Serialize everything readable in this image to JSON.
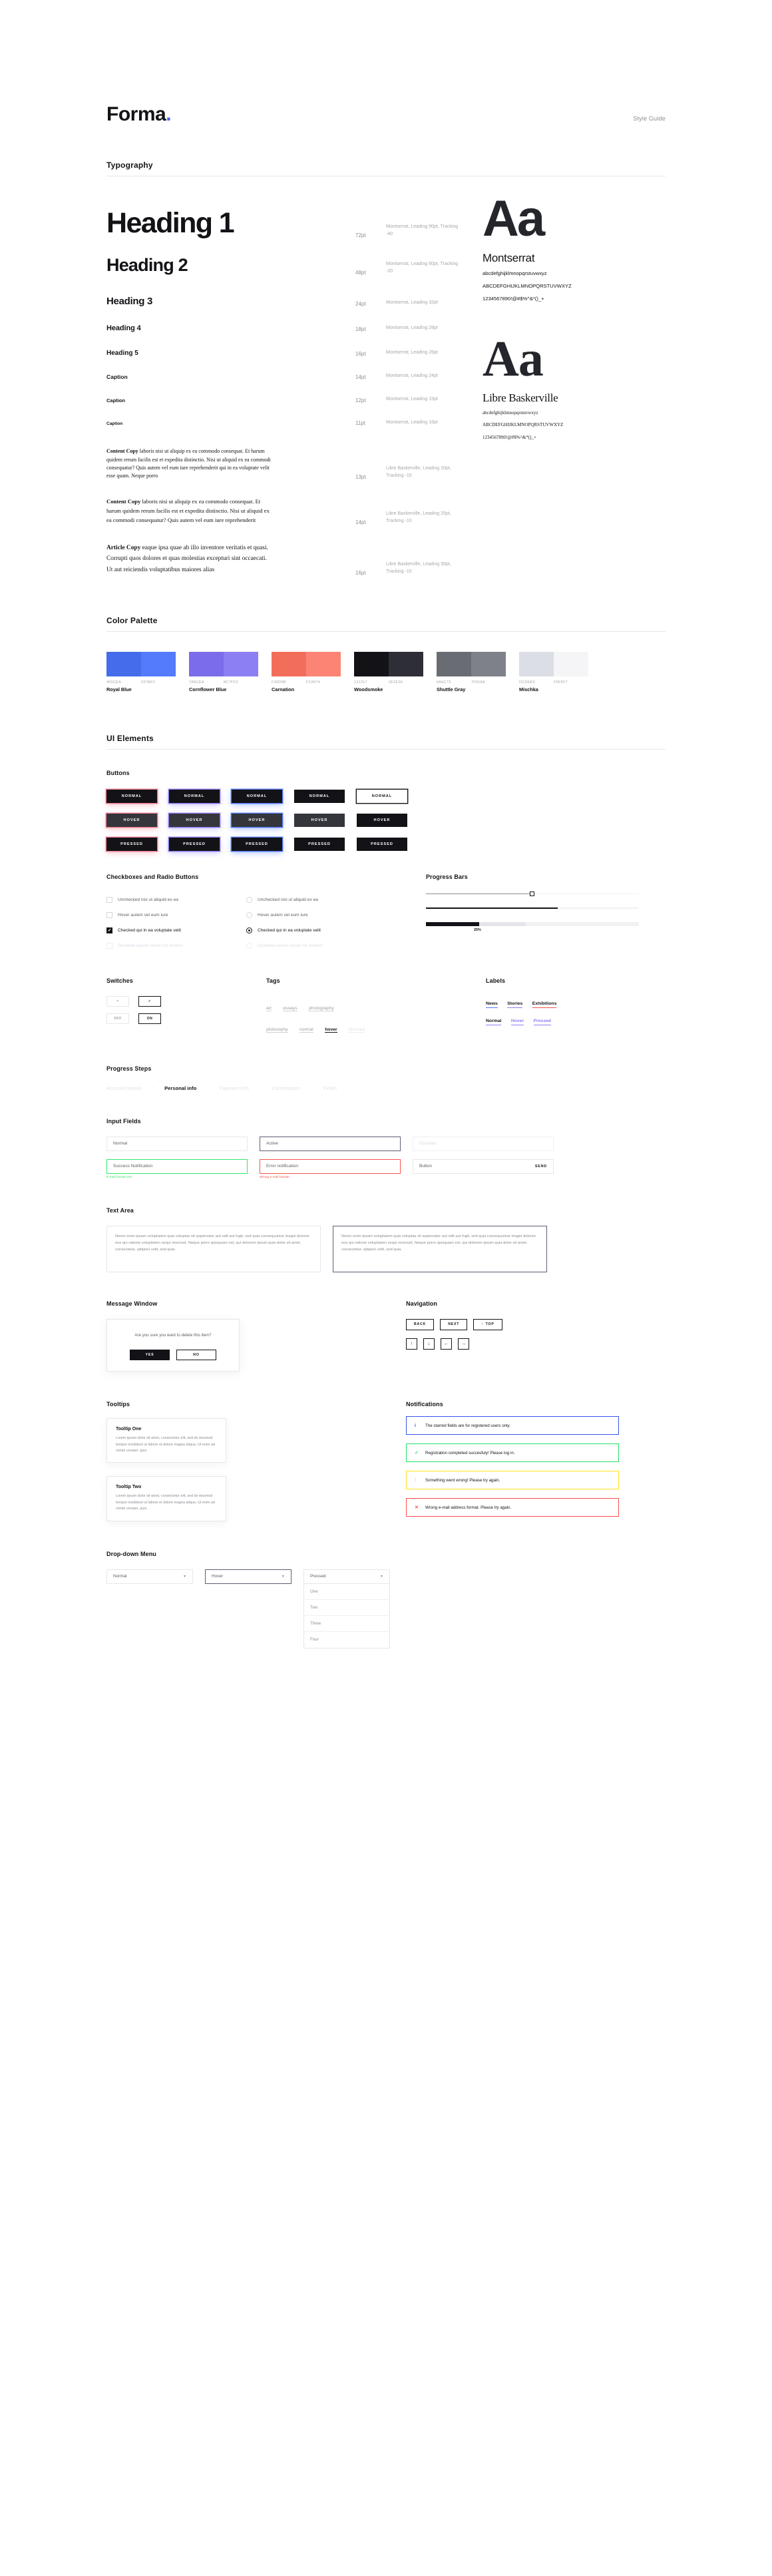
{
  "header": {
    "logo": "Forma",
    "logo_dot": ".",
    "right_label": "Style Guide"
  },
  "sections": {
    "typography": "Typography",
    "palette": "Color Palette",
    "ui": "UI Elements"
  },
  "typography": {
    "rows": [
      {
        "sample": "Heading 1",
        "size": "72pt",
        "spec": "Montserrat, Leading 90pt, Tracking -40"
      },
      {
        "sample": "Heading 2",
        "size": "48pt",
        "spec": "Montserrat, Leading 60pt, Tracking -20"
      },
      {
        "sample": "Heading 3",
        "size": "24pt",
        "spec": "Montserrat, Leading 32pt"
      },
      {
        "sample": "Heading 4",
        "size": "18pt",
        "spec": "Montserrat, Leading 28pt"
      },
      {
        "sample": "Heading 5",
        "size": "16pt",
        "spec": "Montserrat, Leading 26pt"
      },
      {
        "sample": "Caption",
        "size": "14pt",
        "spec": "Montserrat, Leading 24pt"
      },
      {
        "sample": "Caption",
        "size": "12pt",
        "spec": "Montserrat, Leading 15pt"
      },
      {
        "sample": "Caption",
        "size": "11pt",
        "spec": "Montserrat, Leading 16pt"
      }
    ],
    "body_rows": [
      {
        "lead": "Content Copy",
        "text": " laboris nisi ut aliquip ex ea commodo consequat. Et harum quidem rerum facilis est et expedita distinctio. Nisi ut aliquid ex ea commodi consequatur? Quis autem vel eum iure reprehenderit qui in ea voluptate velit esse quam. Neque porro",
        "size": "13pt",
        "spec": "Libre Baskerville, Leading 20pt, Tracking -10"
      },
      {
        "lead": "Content Copy",
        "text": " laboris nisi ut aliquip ex ea commodo consequat. Et harum quidem rerum facilis est et expedita distinctio. Nisi ut aliquid ex ea commodi consequatur? Quis autem vel eum iure reprehenderit",
        "size": "14pt",
        "spec": "Libre Baskerville, Leading 25pt, Tracking -10"
      },
      {
        "lead": "Article Copy",
        "text": " eaque ipsa quae ab illo inventore veritatis et quasi. Corrupti quos dolores et quas molestias excepturi sint occaecati. Ut aut reiciendis voluptatibus maiores alias",
        "size": "16pt",
        "spec": "Libre Baskerville, Leading 30pt, Tracking -10"
      }
    ],
    "specimens": [
      {
        "aa": "Aa",
        "name": "Montserrat",
        "lower": "abcdefghijklmnopqrstuvwxyz",
        "upper": "ABCDEFGHIJKLMNOPQRSTUVWXYZ",
        "symbols": "1234567890!@#$%^&*()_+"
      },
      {
        "aa": "Aa",
        "name": "Libre Baskerville",
        "lower": "abcdefghijklmnopqrstuvwxyz",
        "upper": "ABCDEFGHIJKLMNOPQRSTUVWXYZ",
        "symbols": "1234567890!@#$%^&*()_+"
      }
    ]
  },
  "palette": [
    {
      "name": "Royal Blue",
      "hex1": "456CEA",
      "hex2": "537BFC",
      "c1": "#456CEA",
      "c2": "#537BFC"
    },
    {
      "name": "Cornflower Blue",
      "hex1": "7A6CEA",
      "hex2": "8C7FF3",
      "c1": "#7A6CEA",
      "c2": "#8C7FF3"
    },
    {
      "name": "Carnation",
      "hex1": "F36D5B",
      "hex2": "FC8474",
      "c1": "#F36D5B",
      "c2": "#FC8474"
    },
    {
      "name": "Woodsmoke",
      "hex1": "131317",
      "hex2": "2E2E36",
      "c1": "#131317",
      "c2": "#2E2E36"
    },
    {
      "name": "Shuttle Gray",
      "hex1": "6A6C73",
      "hex2": "7F818A",
      "c1": "#6A6C73",
      "c2": "#7F818A"
    },
    {
      "name": "Mischka",
      "hex1": "DCDEE6",
      "hex2": "F5F5F7",
      "c1": "#DCDEE6",
      "c2": "#F5F5F7"
    }
  ],
  "buttons": {
    "title": "Buttons",
    "normal": "NORMAL",
    "hover": "HOVER",
    "pressed": "PRESSED"
  },
  "checkboxes": {
    "title": "Checkboxes and Radio Buttons",
    "items": [
      "Unchecked nisi ut aliquid ex ea",
      "Hover autem vel eum iure",
      "Checked qui in ea voluptate velit",
      "Disabled earum rerum hic tenetur"
    ]
  },
  "progress_bars": {
    "title": "Progress Bars",
    "percent": "25%"
  },
  "switches": {
    "title": "Switches",
    "off_icon": "×",
    "on_icon": "✓",
    "off": "OFF",
    "on": "ON"
  },
  "tags": {
    "title": "Tags",
    "row1": [
      "art",
      "essays",
      "photography"
    ],
    "row2": [
      "philosophy",
      "normal",
      "hover",
      "pressed"
    ]
  },
  "labels": {
    "title": "Labels",
    "row1": [
      "News",
      "Stories",
      "Exhibitions"
    ],
    "row2": [
      "Normal",
      "Hover",
      "Pressed"
    ]
  },
  "progress_steps": {
    "title": "Progress Steps",
    "steps": [
      "Account Details",
      "Personal info",
      "Payment info",
      "Confirmation",
      "Finish"
    ],
    "active_index": 1,
    "separator": "›"
  },
  "inputs": {
    "title": "Input Fields",
    "normal": "Normal",
    "active": "Active",
    "disabled": "Disabled",
    "success": "Success Notification",
    "success_hint": "E-mail format OK!",
    "error": "Error notification",
    "error_hint": "Wrong e-mail format!",
    "button_field": "Button",
    "send": "SEND"
  },
  "textarea": {
    "title": "Text Area",
    "text": "Nemo enim ipsam voluptatem quia voluptas sit aspernatur aut odit aut fugit, sed quia consequuntur magni dolores eos qui ratione voluptatem sequi nesciunt. Neque porro quisquam est, qui dolorem ipsum quia dolor sit amet, consectetur, adipisci velit, sed quia."
  },
  "message_window": {
    "title": "Message Window",
    "text": "Are you sure you want to delete this item?",
    "yes": "YES",
    "no": "NO"
  },
  "navigation": {
    "title": "Navigation",
    "back": "BACK",
    "next": "NEXT",
    "top": "TOP",
    "top_icon": "↑",
    "arrows": [
      "↑",
      "↓",
      "←",
      "→"
    ]
  },
  "tooltips": {
    "title": "Tooltips",
    "items": [
      {
        "title": "Tooltip One",
        "body": "Lorem ipsum dolor sit amet, consectetur elit, sed do eiusmod tempor incididunt ut labore et dolore magna aliqua. Ut enim ad minim veniam, quis"
      },
      {
        "title": "Tooltip Two",
        "body": "Lorem ipsum dolor sit amet, consectetur elit, sed do eiusmod tempor incididunt ut labore et dolore magna aliqua. Ut enim ad minim veniam, quis"
      }
    ]
  },
  "notifications": {
    "title": "Notifications",
    "items": [
      {
        "icon": "i",
        "text": "The starred fields are for registered users only.",
        "type": "info"
      },
      {
        "icon": "✓",
        "text": "Registration completed succesfuly! Please log in.",
        "type": "ok"
      },
      {
        "icon": "!",
        "text": "Something went wrong! Please try again.",
        "type": "warn"
      },
      {
        "icon": "✕",
        "text": "Wrong e-mail address format. Please try again.",
        "type": "err"
      }
    ]
  },
  "dropdown": {
    "title": "Drop-down Menu",
    "normal": "Normal",
    "hover": "Hover",
    "pressed": "Pressed",
    "caret": "▼",
    "options": [
      "One",
      "Two",
      "Three",
      "Four"
    ]
  }
}
